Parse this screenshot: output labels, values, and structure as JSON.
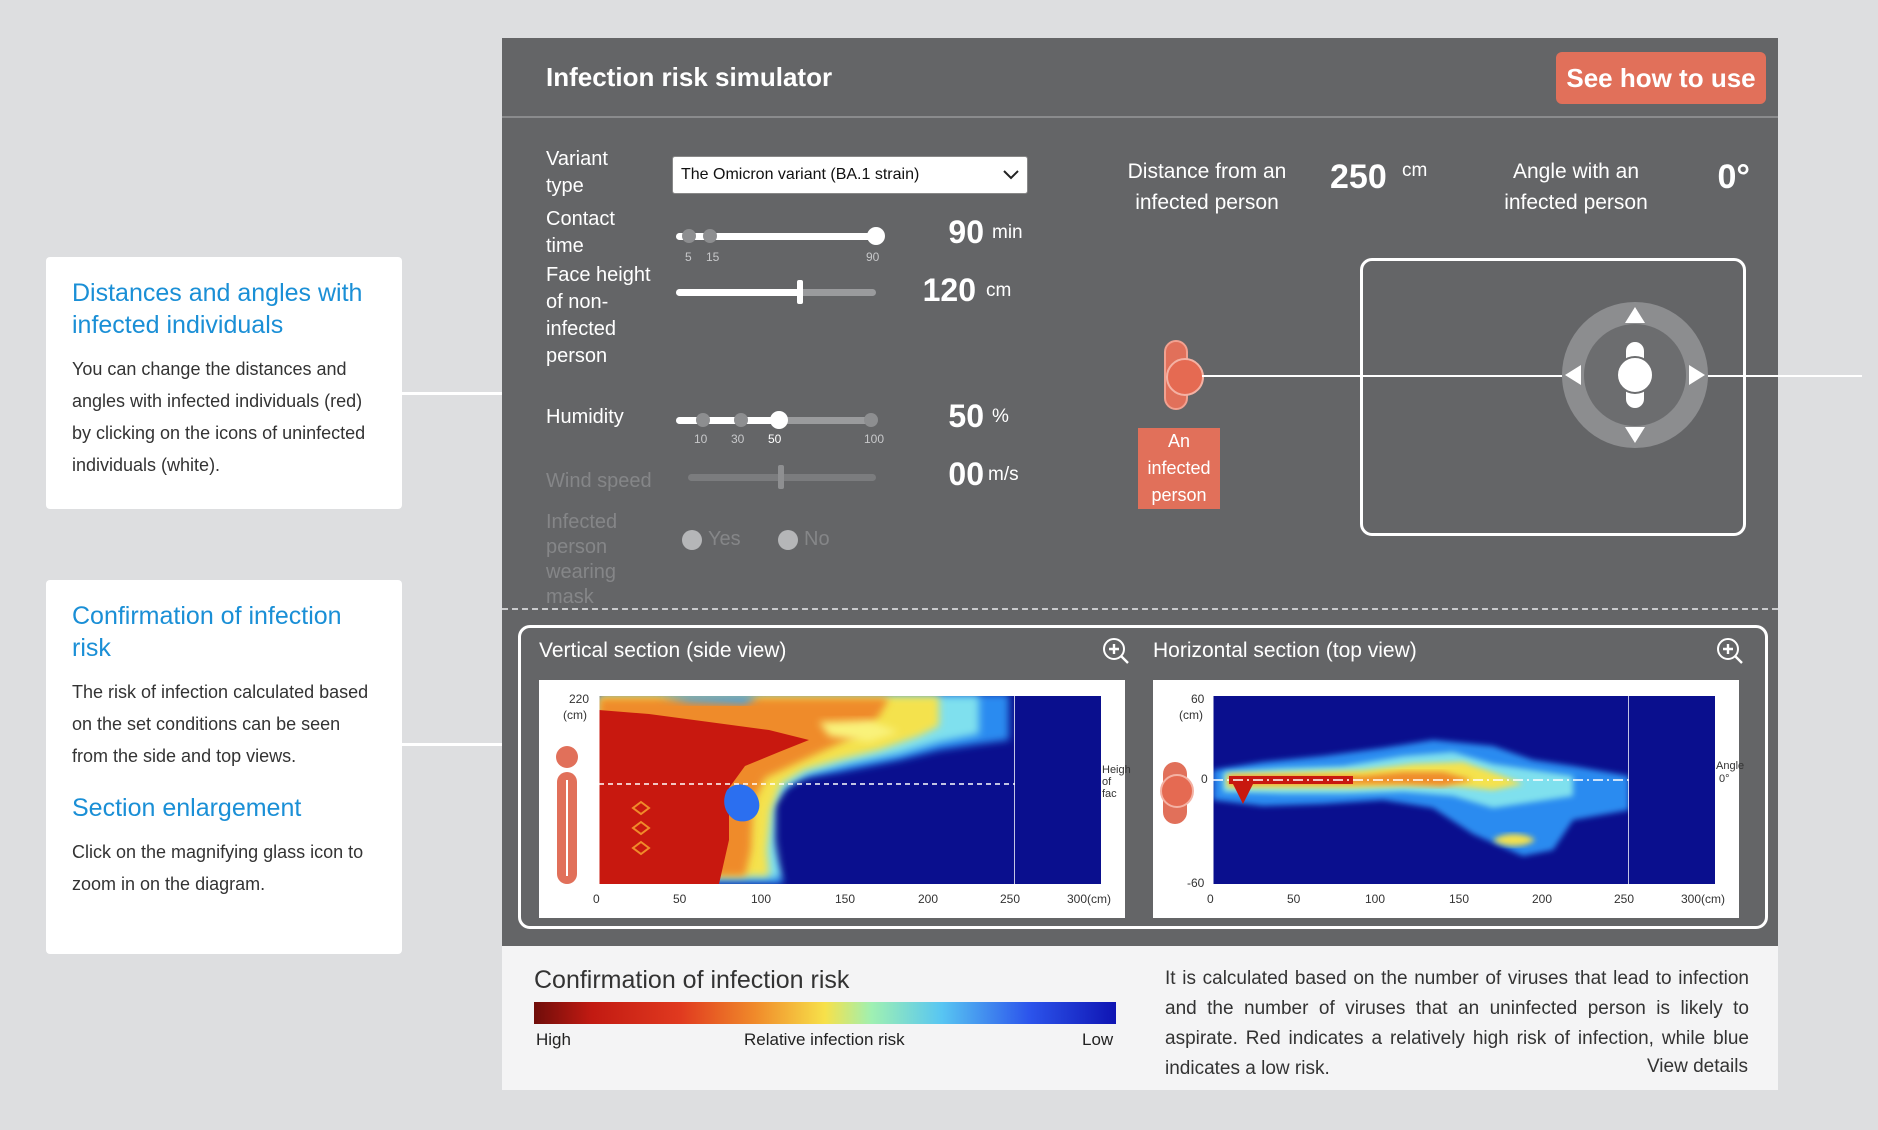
{
  "callouts": {
    "distances": {
      "title": "Distances and angles with infected individuals",
      "body": "You can change the distances and angles with infected individuals (red) by clicking on the icons of uninfected individuals (white)."
    },
    "risk": {
      "title": "Confirmation of infection risk",
      "body": "The risk of infection calculated based on the set conditions can be seen from the side and top views.",
      "title2": "Section enlargement",
      "body2": "Click on the magnifying glass icon to zoom in on the diagram."
    }
  },
  "app": {
    "title": "Infection risk simulator",
    "how_to_button": "See how to use"
  },
  "controls": {
    "variant": {
      "label": "Variant type",
      "selected": "The Omicron variant (BA.1 strain)"
    },
    "contact_time": {
      "label": "Contact time",
      "value": "90",
      "unit": "min",
      "ticks": [
        "5",
        "15",
        "90"
      ],
      "fraction": 1.0
    },
    "face_height": {
      "label": "Face height of non-infected person",
      "value": "120",
      "unit": "cm",
      "fraction": 0.62
    },
    "humidity": {
      "label": "Humidity",
      "value": "50",
      "unit": "%",
      "ticks": [
        "10",
        "30",
        "50",
        "100"
      ]
    },
    "wind_speed": {
      "label": "Wind speed",
      "value": "00",
      "unit": "m/s"
    },
    "mask": {
      "label": "Infected person wearing mask",
      "options": [
        "Yes",
        "No"
      ]
    }
  },
  "position": {
    "distance_label": "Distance from an infected person",
    "distance_value": "250",
    "distance_unit": "cm",
    "angle_label": "Angle with an infected person",
    "angle_value": "0°",
    "infected_tag": "An infected person"
  },
  "sections": {
    "vertical": {
      "title": "Vertical section (side view)",
      "y_top": "220",
      "y_unit": "(cm)",
      "x_ticks": [
        "0",
        "50",
        "100",
        "150",
        "200",
        "250",
        "300(cm)"
      ],
      "side_label_1": "Heigh",
      "side_label_2": "of fac"
    },
    "horizontal": {
      "title": "Horizontal section (top view)",
      "y_top": "60",
      "y_unit": "(cm)",
      "y_mid": "0",
      "y_bottom": "-60",
      "x_ticks": [
        "0",
        "50",
        "100",
        "150",
        "200",
        "250",
        "300(cm)"
      ],
      "side_label_1": "Angle",
      "side_label_2": "0°"
    }
  },
  "legend": {
    "title": "Confirmation of infection risk",
    "high": "High",
    "mid": "Relative infection risk",
    "low": "Low",
    "description": "It is calculated based on the number of viruses that lead to infection and the number of viruses that an uninfected person is likely to aspirate. Red indicates a relatively high risk of infection, while blue indicates a low risk.",
    "details_link": "View details"
  },
  "colors": {
    "panel": "#646567",
    "accent": "#e1705a",
    "link": "#1a8fd6"
  }
}
